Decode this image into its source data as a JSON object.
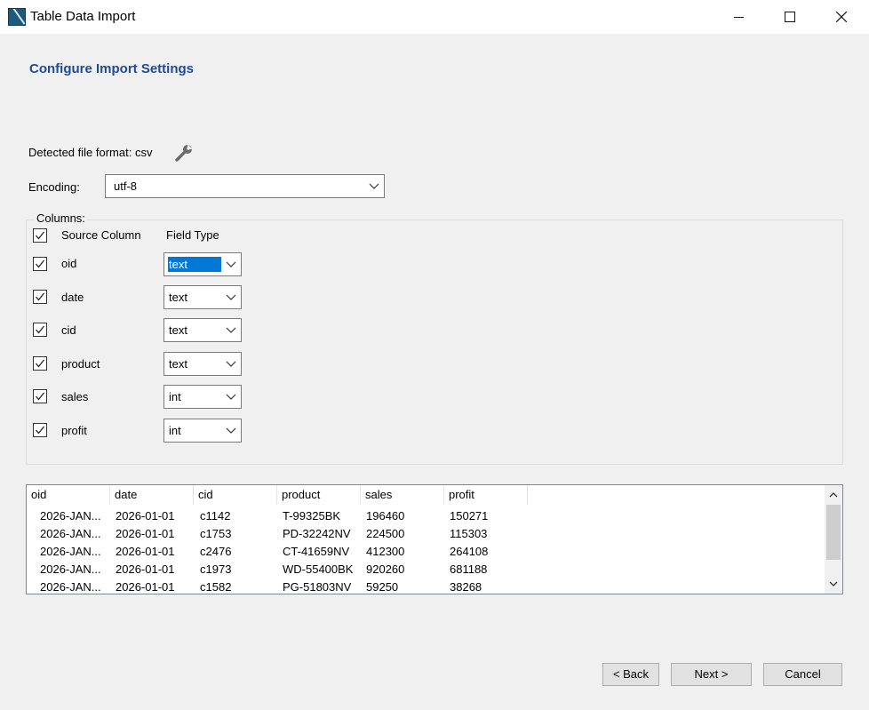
{
  "window": {
    "title": "Table Data Import"
  },
  "page": {
    "heading": "Configure Import Settings"
  },
  "format": {
    "label": "Detected file format: csv"
  },
  "encoding": {
    "label": "Encoding:",
    "value": "utf-8"
  },
  "columns": {
    "group_label": "Columns:",
    "header_source": "Source Column",
    "header_type": "Field Type",
    "items": [
      {
        "name": "oid",
        "type": "text",
        "checked": true
      },
      {
        "name": "date",
        "type": "text",
        "checked": true
      },
      {
        "name": "cid",
        "type": "text",
        "checked": true
      },
      {
        "name": "product",
        "type": "text",
        "checked": true
      },
      {
        "name": "sales",
        "type": "int",
        "checked": true
      },
      {
        "name": "profit",
        "type": "int",
        "checked": true
      }
    ]
  },
  "preview": {
    "headers": [
      "oid",
      "date",
      "cid",
      "product",
      "sales",
      "profit"
    ],
    "rows": [
      [
        "2026-JAN...",
        "2026-01-01",
        "c1142",
        "T-99325BK",
        "196460",
        "150271"
      ],
      [
        "2026-JAN...",
        "2026-01-01",
        "c1753",
        "PD-32242NV",
        "224500",
        "115303"
      ],
      [
        "2026-JAN...",
        "2026-01-01",
        "c2476",
        "CT-41659NV",
        "412300",
        "264108"
      ],
      [
        "2026-JAN...",
        "2026-01-01",
        "c1973",
        "WD-55400BK",
        "920260",
        "681188"
      ],
      [
        "2026-JAN...",
        "2026-01-01",
        "c1582",
        "PG-51803NV",
        "59250",
        "38268"
      ]
    ]
  },
  "buttons": {
    "back": "< Back",
    "next": "Next >",
    "cancel": "Cancel"
  },
  "colors": {
    "heading": "#1f4a96",
    "selection": "#0078d7"
  },
  "icons": {
    "app": "app-icon",
    "wrench": "wrench-icon",
    "chevron": "chevron-down-icon",
    "check": "check-icon"
  }
}
